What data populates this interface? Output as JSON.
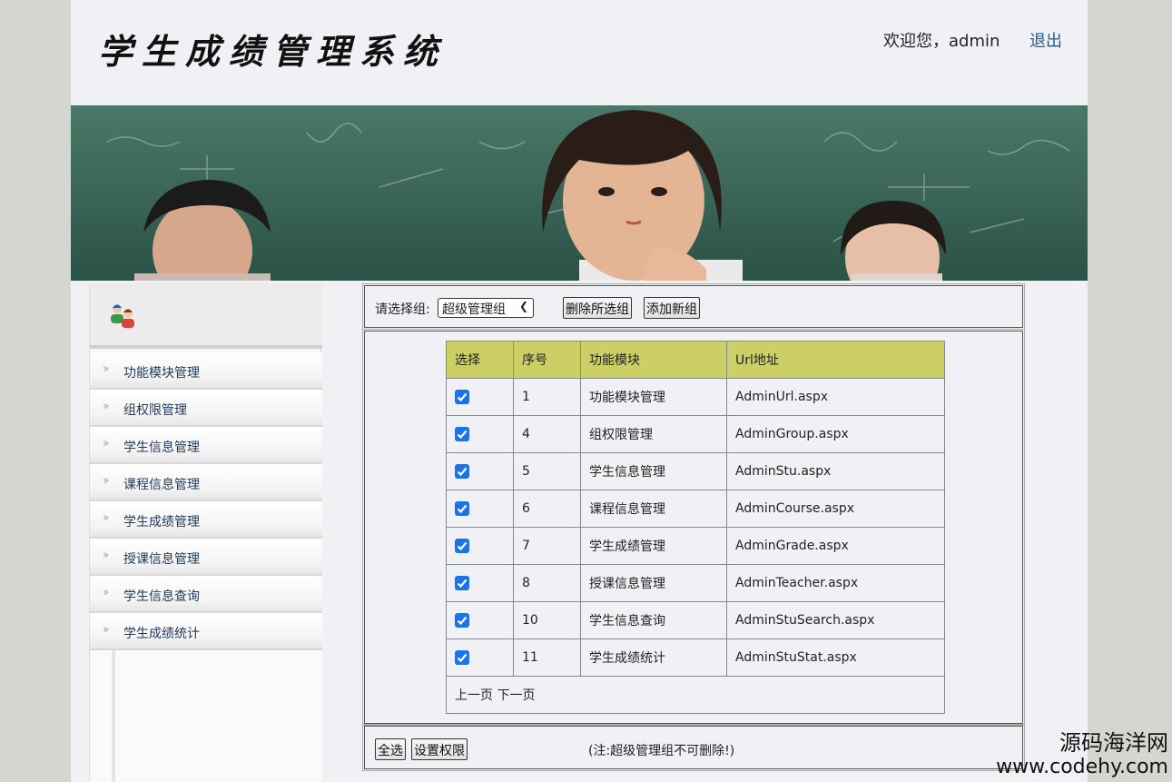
{
  "header": {
    "title": "学生成绩管理系统",
    "welcome": "欢迎您，admin",
    "logout": "退出"
  },
  "sidebar": {
    "icon": "users-icon",
    "items": [
      {
        "label": "功能模块管理"
      },
      {
        "label": "组权限管理"
      },
      {
        "label": "学生信息管理"
      },
      {
        "label": "课程信息管理"
      },
      {
        "label": "学生成绩管理"
      },
      {
        "label": "授课信息管理"
      },
      {
        "label": "学生信息查询"
      },
      {
        "label": "学生成绩统计"
      }
    ]
  },
  "toolbar": {
    "select_label": "请选择组:",
    "selected_group": "超级管理组",
    "delete_button": "删除所选组",
    "add_button": "添加新组"
  },
  "table": {
    "headers": [
      "选择",
      "序号",
      "功能模块",
      "Url地址"
    ],
    "rows": [
      {
        "checked": true,
        "id": "1",
        "module": "功能模块管理",
        "url": "AdminUrl.aspx"
      },
      {
        "checked": true,
        "id": "4",
        "module": "组权限管理",
        "url": "AdminGroup.aspx"
      },
      {
        "checked": true,
        "id": "5",
        "module": "学生信息管理",
        "url": "AdminStu.aspx"
      },
      {
        "checked": true,
        "id": "6",
        "module": "课程信息管理",
        "url": "AdminCourse.aspx"
      },
      {
        "checked": true,
        "id": "7",
        "module": "学生成绩管理",
        "url": "AdminGrade.aspx"
      },
      {
        "checked": true,
        "id": "8",
        "module": "授课信息管理",
        "url": "AdminTeacher.aspx"
      },
      {
        "checked": true,
        "id": "10",
        "module": "学生信息查询",
        "url": "AdminStuSearch.aspx"
      },
      {
        "checked": true,
        "id": "11",
        "module": "学生成绩统计",
        "url": "AdminStuStat.aspx"
      }
    ],
    "pager": {
      "prev": "上一页",
      "next": "下一页"
    }
  },
  "footer": {
    "select_all": "全选",
    "set_permission": "设置权限",
    "note": "(注:超级管理组不可删除!)"
  },
  "watermark": {
    "line1": "源码海洋网",
    "line2": "www.codehy.com"
  },
  "colors": {
    "header_bg": "#f0f1f4",
    "table_header_bg": "#cccf66",
    "checkbox": "#1a73e8",
    "link": "#2a5a86",
    "chalkboard": "#2d5a4c"
  }
}
